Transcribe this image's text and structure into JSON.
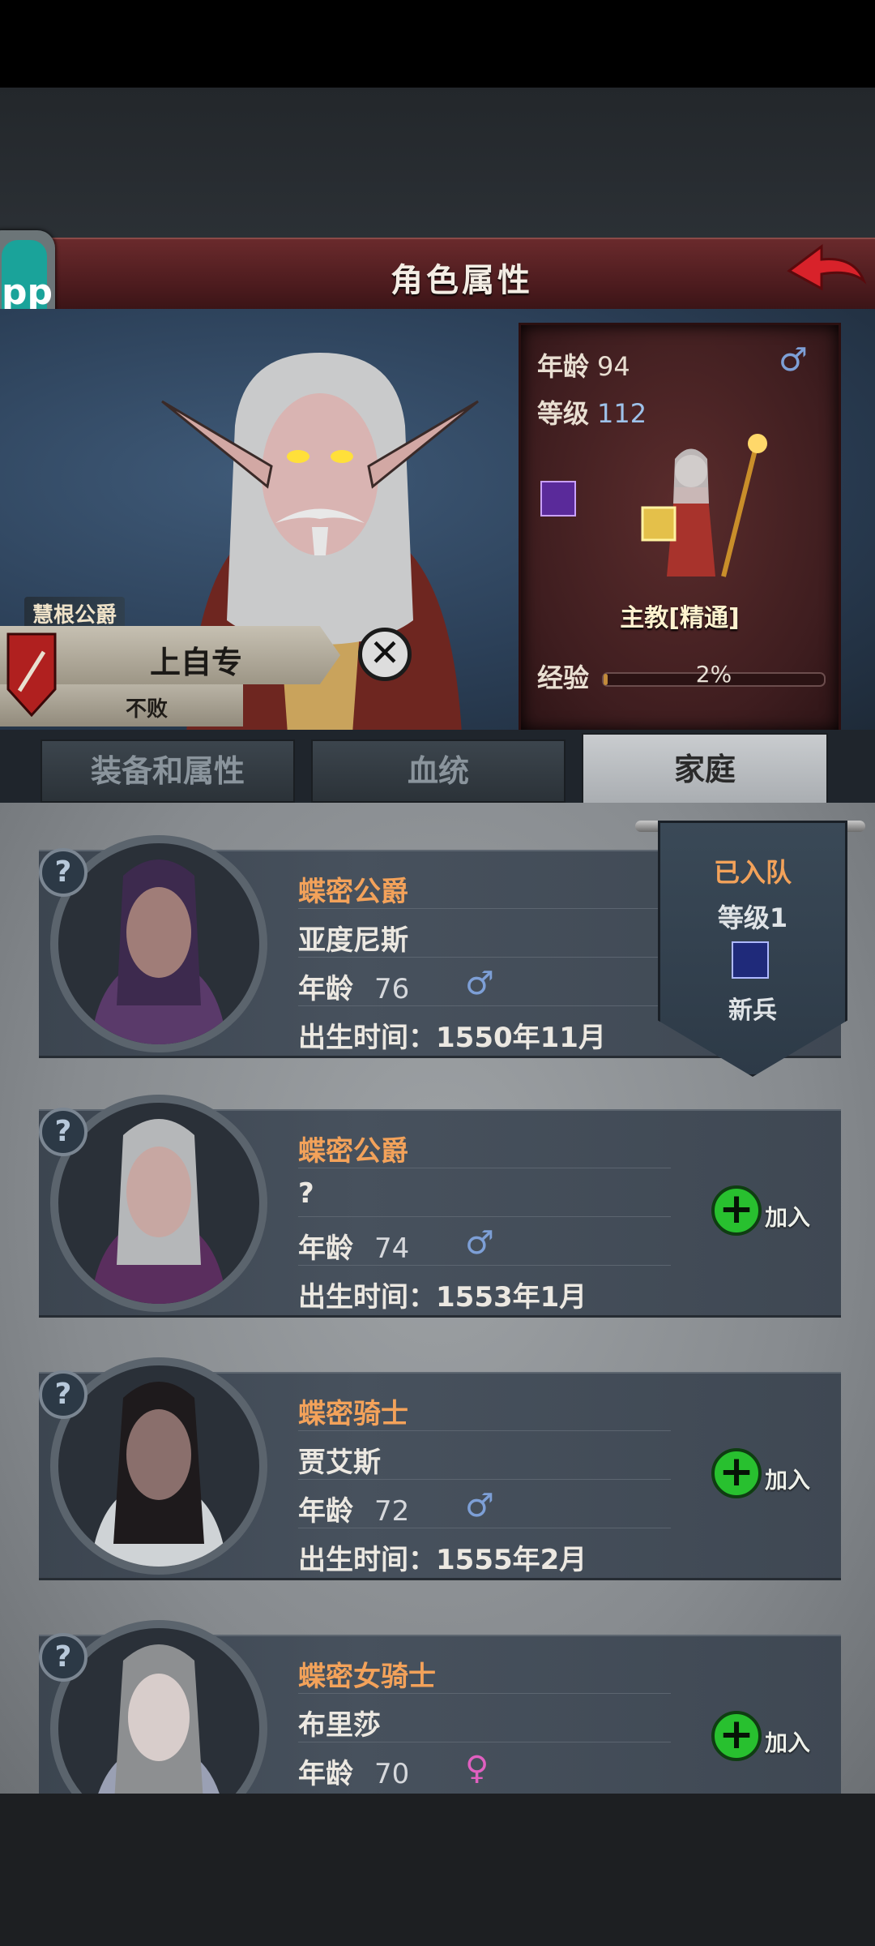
{
  "header": {
    "title": "角色属性",
    "app_label": "pp"
  },
  "hero": {
    "title_badge": "慧根公爵",
    "name": "上自专",
    "subtitle": "不败",
    "close_symbol": "✕",
    "stats": {
      "age_label": "年龄",
      "age_value": "94",
      "level_label": "等级",
      "level_value": "112",
      "class_name": "主教[精通]",
      "exp_label": "经验",
      "exp_value": "2%",
      "exp_fraction": 0.02,
      "gender_symbol": "♂"
    }
  },
  "tabs": [
    {
      "label": "装备和属性"
    },
    {
      "label": "血统"
    },
    {
      "label": "家庭"
    }
  ],
  "family": [
    {
      "rank": "蝶密公爵",
      "name": "亚度尼斯",
      "age_label": "年龄",
      "age": "76",
      "sex": "♂",
      "birth": "出生时间：1550年11月",
      "help": "?"
    },
    {
      "rank": "蝶密公爵",
      "name": "?",
      "age_label": "年龄",
      "age": "74",
      "sex": "♂",
      "birth": "出生时间：1553年1月",
      "help": "?",
      "action": "加入"
    },
    {
      "rank": "蝶密骑士",
      "name": "贾艾斯",
      "age_label": "年龄",
      "age": "72",
      "sex": "♂",
      "birth": "出生时间：1555年2月",
      "help": "?",
      "action": "加入"
    },
    {
      "rank": "蝶密女骑士",
      "name": "布里莎",
      "age_label": "年龄",
      "age": "70",
      "sex": "♀",
      "help": "?",
      "action": "加入"
    }
  ],
  "banner": {
    "status": "已入队",
    "level": "等级1",
    "type": "新兵"
  },
  "colors": {
    "accent_orange": "#f3a25a",
    "male_blue": "#7d9fd6",
    "female_pink": "#e060c0",
    "join_green": "#28c02f"
  }
}
